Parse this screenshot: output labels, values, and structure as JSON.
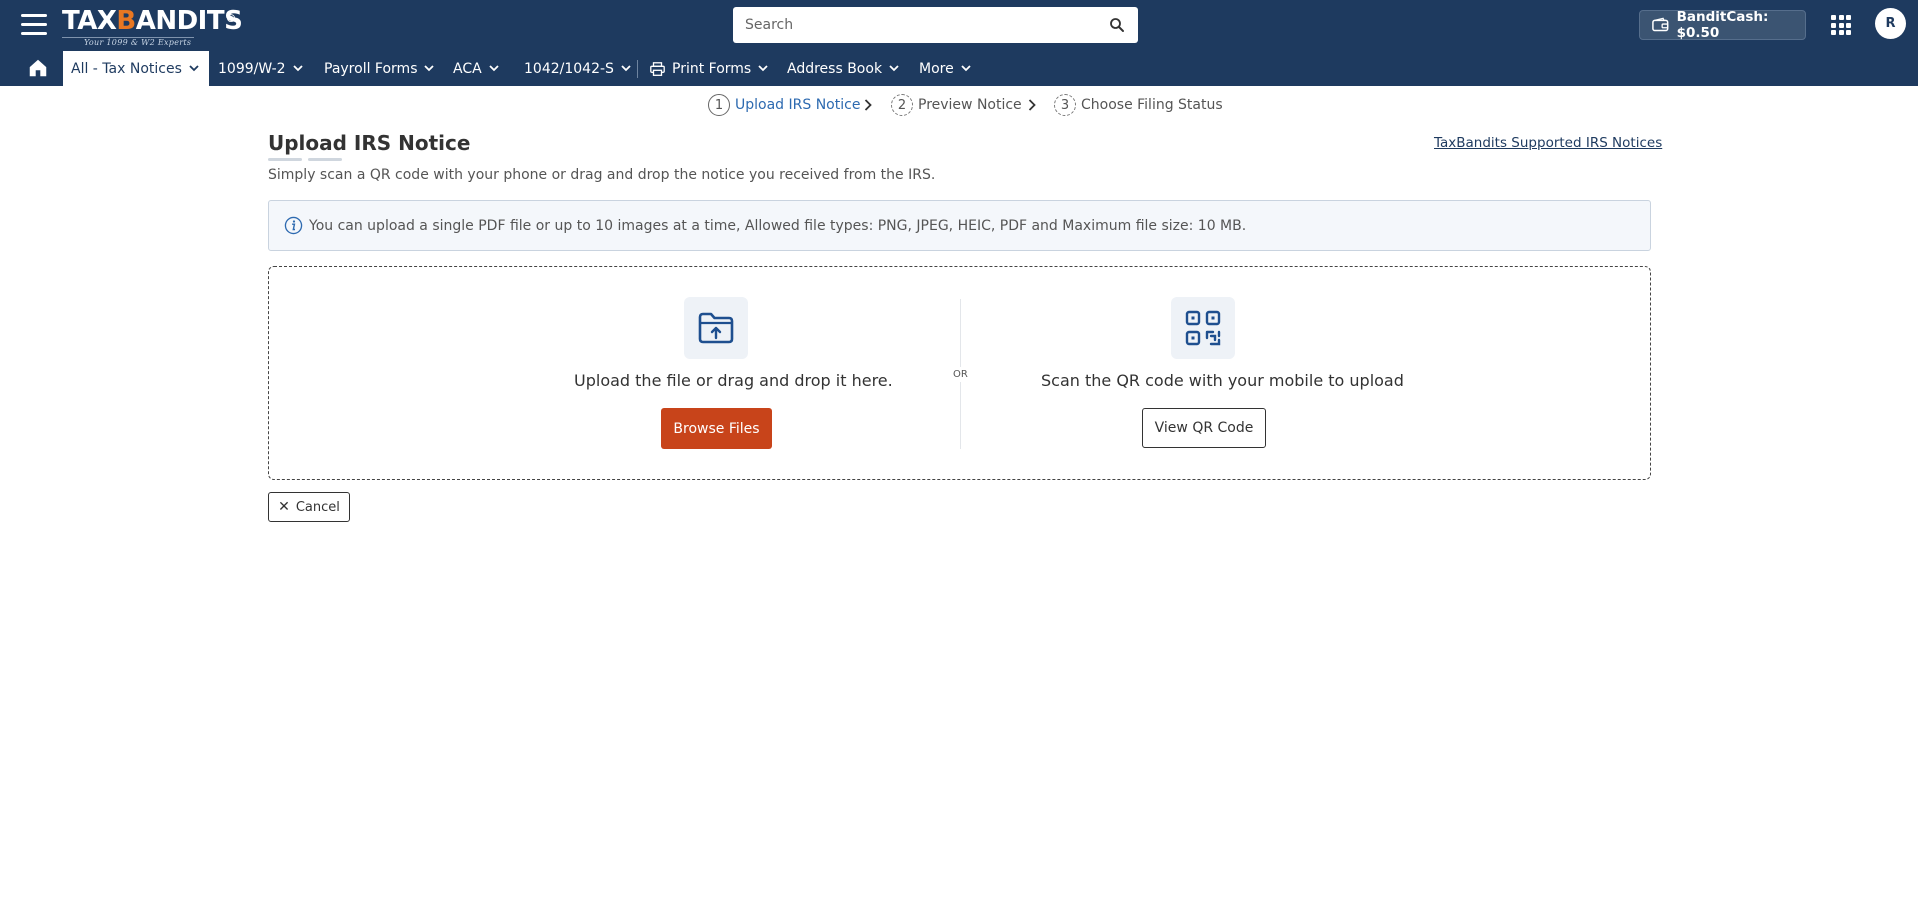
{
  "header": {
    "logo": {
      "main_prefix": "TAX",
      "main_owl": "B",
      "main_suffix": "ANDITS",
      "registered": "®",
      "tagline": "Your 1099 & W2 Experts"
    },
    "search": {
      "placeholder": "Search"
    },
    "bandit_cash": {
      "label": "BanditCash: $0.50"
    },
    "avatar": {
      "initial": "R"
    }
  },
  "nav": {
    "items": [
      {
        "label": "All - Tax Notices",
        "active": true
      },
      {
        "label": "1099/W-2"
      },
      {
        "label": "Payroll Forms"
      },
      {
        "label": "ACA"
      },
      {
        "label": "1042/1042-S"
      },
      {
        "label": "Print Forms"
      },
      {
        "label": "Address Book"
      },
      {
        "label": "More"
      }
    ]
  },
  "stepper": {
    "steps": [
      {
        "num": "1",
        "label": "Upload IRS Notice"
      },
      {
        "num": "2",
        "label": "Preview Notice"
      },
      {
        "num": "3",
        "label": "Choose Filing Status"
      }
    ]
  },
  "page": {
    "title": "Upload IRS Notice",
    "supported_link": "TaxBandits Supported IRS Notices",
    "subtitle": "Simply scan a QR code with your phone or drag and drop the notice you received from the IRS.",
    "info": "You can upload a single PDF file or up to 10 images at a time, Allowed file types: PNG, JPEG, HEIC, PDF and Maximum file size: 10 MB."
  },
  "upload": {
    "left_text": "Upload the file or drag and drop it here.",
    "browse_label": "Browse Files",
    "or_label": "OR",
    "right_text": "Scan the QR code with your mobile to upload",
    "qr_label": "View QR Code"
  },
  "actions": {
    "cancel_label": "Cancel"
  },
  "colors": {
    "header_bg": "#1e3a5f",
    "primary_button": "#c8441a",
    "link": "#2d6ab0"
  }
}
